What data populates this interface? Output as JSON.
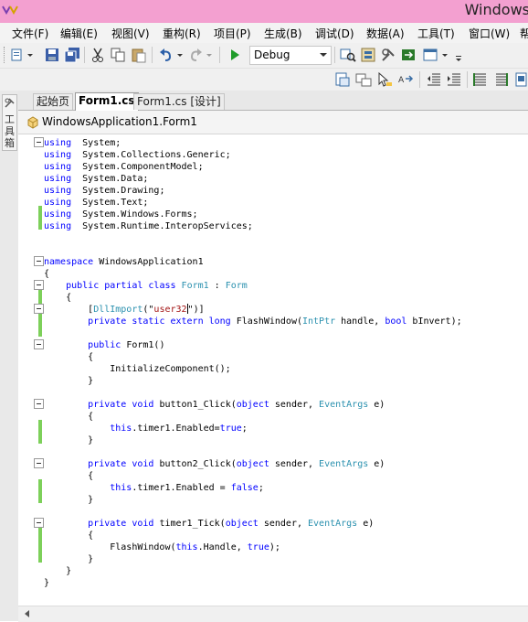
{
  "window": {
    "title": "Windows"
  },
  "menu": [
    "文件(F)",
    "编辑(E)",
    "视图(V)",
    "重构(R)",
    "项目(P)",
    "生成(B)",
    "调试(D)",
    "数据(A)",
    "工具(T)",
    "窗口(W)",
    "帮"
  ],
  "toolbar": {
    "configuration": "Debug"
  },
  "toolbox": {
    "label": "工具箱"
  },
  "tabs": [
    {
      "label": "起始页",
      "active": false
    },
    {
      "label": "Form1.cs",
      "active": true
    },
    {
      "label": "Form1.cs [设计]",
      "active": false
    }
  ],
  "navbar": {
    "class_name": "WindowsApplication1.Form1"
  },
  "code_lines": [
    [
      [
        "kw",
        "using"
      ],
      [
        "",
        "  System;"
      ]
    ],
    [
      [
        "kw",
        "using"
      ],
      [
        "",
        "  System.Collections.Generic;"
      ]
    ],
    [
      [
        "kw",
        "using"
      ],
      [
        "",
        "  System.ComponentModel;"
      ]
    ],
    [
      [
        "kw",
        "using"
      ],
      [
        "",
        "  System.Data;"
      ]
    ],
    [
      [
        "kw",
        "using"
      ],
      [
        "",
        "  System.Drawing;"
      ]
    ],
    [
      [
        "kw",
        "using"
      ],
      [
        "",
        "  System.Text;"
      ]
    ],
    [
      [
        "kw",
        "using"
      ],
      [
        "",
        "  System.Windows.Forms;"
      ]
    ],
    [
      [
        "kw",
        "using"
      ],
      [
        "",
        "  System.Runtime.InteropServices;"
      ]
    ],
    [],
    [],
    [
      [
        "kw",
        "namespace"
      ],
      [
        "",
        " WindowsApplication1"
      ]
    ],
    [
      [
        "",
        "{"
      ]
    ],
    [
      [
        "",
        "    "
      ],
      [
        "kw",
        "public partial class"
      ],
      [
        "",
        " "
      ],
      [
        "ty",
        "Form1"
      ],
      [
        "",
        " : "
      ],
      [
        "ty",
        "Form"
      ]
    ],
    [
      [
        "",
        "    {"
      ]
    ],
    [
      [
        "",
        "        ["
      ],
      [
        "ty",
        "DllImport"
      ],
      [
        "",
        "(\""
      ],
      [
        "str",
        "user32"
      ],
      [
        "caret",
        ""
      ],
      [
        "",
        "\")]"
      ]
    ],
    [
      [
        "",
        "        "
      ],
      [
        "kw",
        "private static extern long"
      ],
      [
        "",
        " FlashWindow("
      ],
      [
        "ty",
        "IntPtr"
      ],
      [
        "",
        " handle, "
      ],
      [
        "kw",
        "bool"
      ],
      [
        "",
        " bInvert);"
      ]
    ],
    [],
    [
      [
        "",
        "        "
      ],
      [
        "kw",
        "public"
      ],
      [
        "",
        " Form1()"
      ]
    ],
    [
      [
        "",
        "        {"
      ]
    ],
    [
      [
        "",
        "            InitializeComponent();"
      ]
    ],
    [
      [
        "",
        "        }"
      ]
    ],
    [],
    [
      [
        "",
        "        "
      ],
      [
        "kw",
        "private void"
      ],
      [
        "",
        " button1_Click("
      ],
      [
        "kw",
        "object"
      ],
      [
        "",
        " sender, "
      ],
      [
        "ty",
        "EventArgs"
      ],
      [
        "",
        " e)"
      ]
    ],
    [
      [
        "",
        "        {"
      ]
    ],
    [
      [
        "",
        "            "
      ],
      [
        "kw",
        "this"
      ],
      [
        "",
        ".timer1.Enabled="
      ],
      [
        "kw",
        "true"
      ],
      [
        "",
        ";"
      ]
    ],
    [
      [
        "",
        "        }"
      ]
    ],
    [],
    [
      [
        "",
        "        "
      ],
      [
        "kw",
        "private void"
      ],
      [
        "",
        " button2_Click("
      ],
      [
        "kw",
        "object"
      ],
      [
        "",
        " sender, "
      ],
      [
        "ty",
        "EventArgs"
      ],
      [
        "",
        " e)"
      ]
    ],
    [
      [
        "",
        "        {"
      ]
    ],
    [
      [
        "",
        "            "
      ],
      [
        "kw",
        "this"
      ],
      [
        "",
        ".timer1.Enabled = "
      ],
      [
        "kw",
        "false"
      ],
      [
        "",
        ";"
      ]
    ],
    [
      [
        "",
        "        }"
      ]
    ],
    [],
    [
      [
        "",
        "        "
      ],
      [
        "kw",
        "private void"
      ],
      [
        "",
        " timer1_Tick("
      ],
      [
        "kw",
        "object"
      ],
      [
        "",
        " sender, "
      ],
      [
        "ty",
        "EventArgs"
      ],
      [
        "",
        " e)"
      ]
    ],
    [
      [
        "",
        "        {"
      ]
    ],
    [
      [
        "",
        "            FlashWindow("
      ],
      [
        "kw",
        "this"
      ],
      [
        "",
        ".Handle, "
      ],
      [
        "kw",
        "true"
      ],
      [
        "",
        ");"
      ]
    ],
    [
      [
        "",
        "        }"
      ]
    ],
    [
      [
        "",
        "    }"
      ]
    ],
    [
      [
        "",
        "}"
      ]
    ]
  ],
  "colors": {
    "titlebar": "#f3a0d0",
    "keyword": "#0000ff",
    "type": "#2b91af",
    "string": "#a31515",
    "change_bar": "#7dd05a"
  }
}
